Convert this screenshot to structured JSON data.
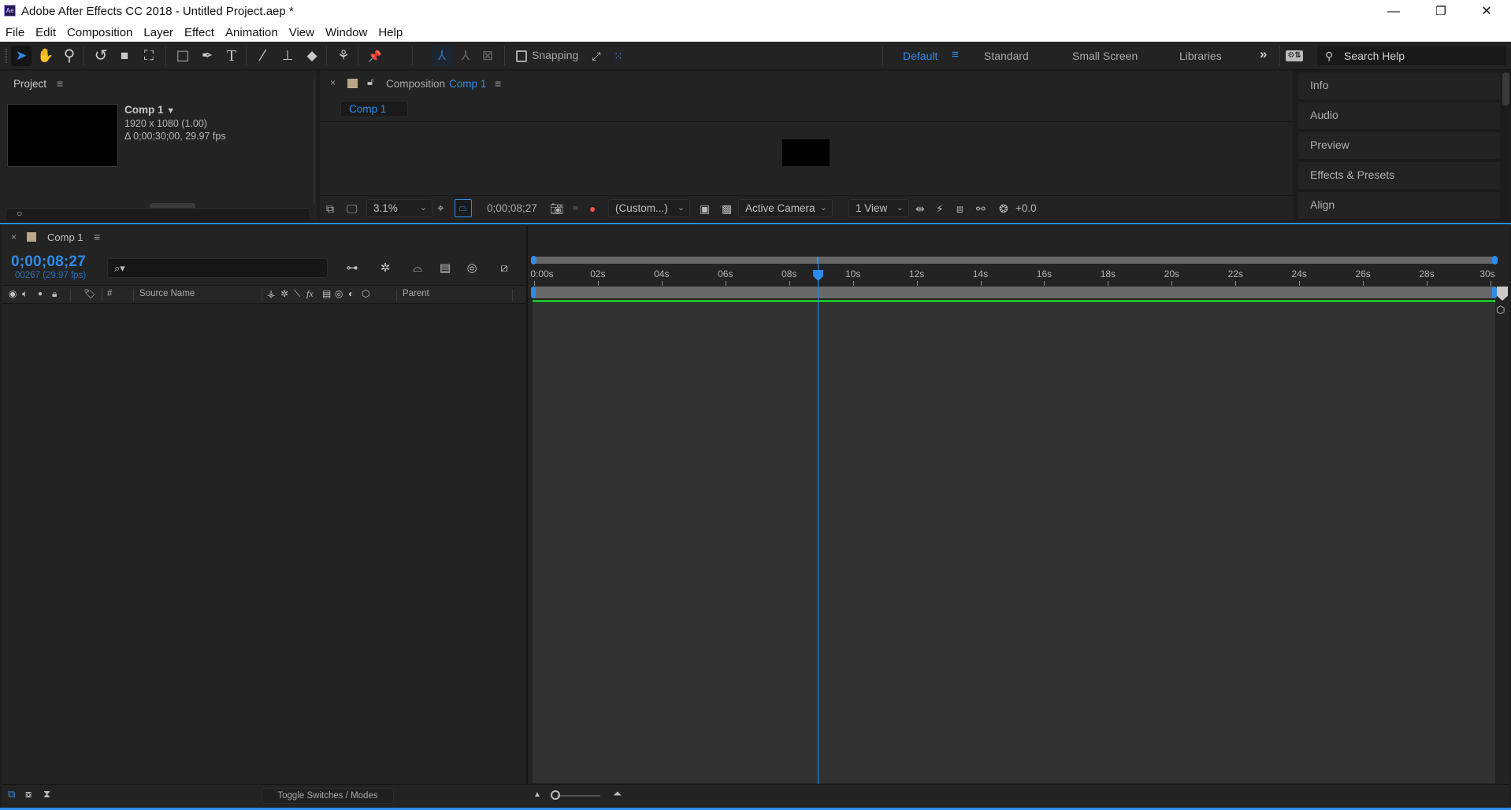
{
  "window": {
    "title": "Adobe After Effects CC 2018 - Untitled Project.aep *",
    "app_icon_label": "Ae",
    "controls": {
      "minimize": "—",
      "maximize": "❐",
      "close": "✕"
    }
  },
  "menu": [
    "File",
    "Edit",
    "Composition",
    "Layer",
    "Effect",
    "Animation",
    "View",
    "Window",
    "Help"
  ],
  "toolbar": {
    "tools": [
      {
        "name": "selection-tool",
        "glyph": "➤",
        "active": true
      },
      {
        "name": "hand-tool",
        "glyph": "✋"
      },
      {
        "name": "zoom-tool",
        "glyph": "⚲"
      },
      {
        "name": "rotation-tool",
        "glyph": "↺"
      },
      {
        "name": "camera-tool",
        "glyph": "■"
      },
      {
        "name": "pan-behind-tool",
        "glyph": "⛶"
      },
      {
        "name": "rectangle-tool",
        "glyph": "□"
      },
      {
        "name": "pen-tool",
        "glyph": "✒"
      },
      {
        "name": "type-tool",
        "glyph": "T"
      },
      {
        "name": "brush-tool",
        "glyph": "⁄"
      },
      {
        "name": "clone-stamp-tool",
        "glyph": "⊥"
      },
      {
        "name": "eraser-tool",
        "glyph": "◆"
      },
      {
        "name": "roto-brush-tool",
        "glyph": "⚘"
      },
      {
        "name": "puppet-pin-tool",
        "glyph": "📌"
      }
    ],
    "axis_tools": [
      "⅄",
      "⅄",
      "⊠"
    ],
    "snapping_label": "Snapping",
    "workspaces": [
      {
        "label": "Default",
        "active": true
      },
      {
        "label": "Standard"
      },
      {
        "label": "Small Screen"
      },
      {
        "label": "Libraries"
      }
    ],
    "more_glyph": "»",
    "search_help_placeholder": "Search Help"
  },
  "project_panel": {
    "title": "Project",
    "item": {
      "name": "Comp 1",
      "dimensions": "1920 x 1080 (1.00)",
      "duration": "Δ 0;00;30;00, 29.97 fps"
    }
  },
  "composition_panel": {
    "title_prefix": "Composition",
    "title_comp": "Comp 1",
    "active_tab": "Comp 1",
    "footer": {
      "magnification": "3.1%",
      "timecode": "0;00;08;27",
      "resolution": "(Custom...)",
      "camera": "Active Camera",
      "views": "1 View",
      "exposure": "+0.0"
    }
  },
  "right_panels": [
    "Info",
    "Audio",
    "Preview",
    "Effects & Presets",
    "Align"
  ],
  "timeline": {
    "tab": "Comp 1",
    "current_time": "0;00;08;27",
    "current_frame": "00267 (29.97 fps)",
    "search_placeholder": "⌕▾",
    "columns": {
      "number": "#",
      "source_name": "Source Name",
      "parent": "Parent"
    },
    "ruler_labels": [
      "0:00s",
      "02s",
      "04s",
      "06s",
      "08s",
      "10s",
      "12s",
      "14s",
      "16s",
      "18s",
      "20s",
      "22s",
      "24s",
      "26s",
      "28s",
      "30s"
    ],
    "duration_seconds": 30,
    "playhead_seconds": 8.9,
    "toggle_label": "Toggle Switches / Modes"
  },
  "colors": {
    "accent": "#2d8ceb",
    "panel_bg": "#232323",
    "track_bg": "#313131",
    "cache_green": "#1fbe2a",
    "label_tan": "#b9a789"
  }
}
